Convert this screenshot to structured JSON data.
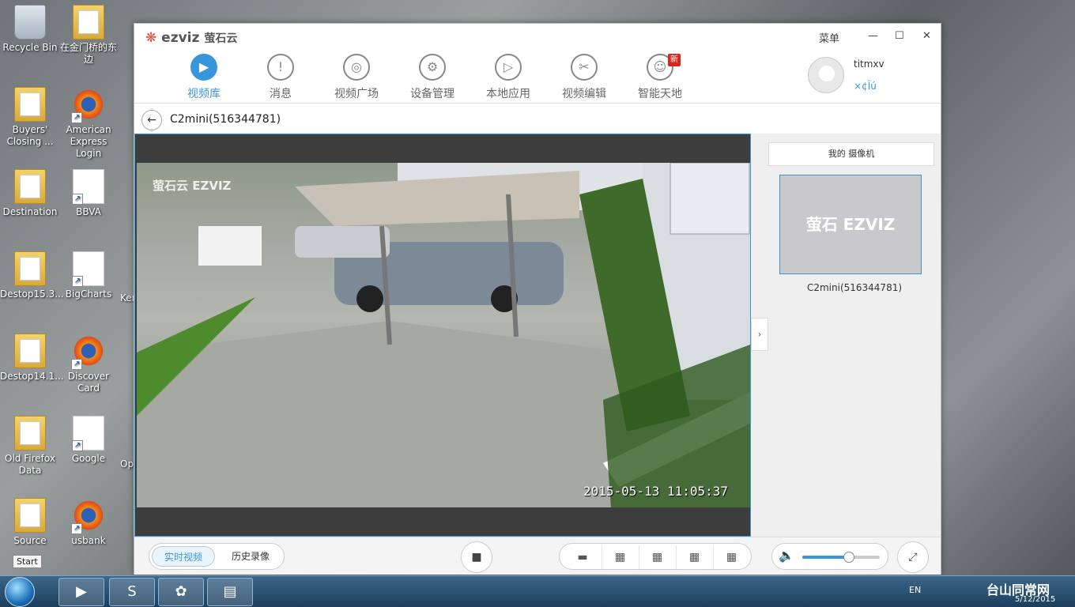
{
  "desktop": {
    "icons": [
      {
        "label": "Recycle Bin",
        "type": "trash"
      },
      {
        "label": "在金门桥的东边",
        "type": "folder"
      },
      {
        "label": "Buyers' Closing ...",
        "type": "folder"
      },
      {
        "label": "American Express Login",
        "type": "firefox"
      },
      {
        "label": "Destination",
        "type": "folder"
      },
      {
        "label": "BBVA",
        "type": "doc"
      },
      {
        "label": "Destop15.3...",
        "type": "folder"
      },
      {
        "label": "BigCharts",
        "type": "doc"
      },
      {
        "label": "Destop14.1...",
        "type": "folder"
      },
      {
        "label": "Discover Card",
        "type": "firefox"
      },
      {
        "label": "Old Firefox Data",
        "type": "folder"
      },
      {
        "label": "Google",
        "type": "doc"
      },
      {
        "label": "Source",
        "type": "folder"
      },
      {
        "label": "usbank",
        "type": "firefox"
      }
    ],
    "partial_labels": [
      "Ker",
      "Op"
    ],
    "start_tooltip": "Start"
  },
  "app": {
    "logo_text": "ezviz",
    "logo_cn": "萤石云",
    "menu_label": "菜单",
    "minimize": "—",
    "maximize": "☐",
    "close": "✕",
    "nav": [
      {
        "label": "视频库",
        "icon": "▶",
        "active": true
      },
      {
        "label": "消息",
        "icon": "!"
      },
      {
        "label": "视频广场",
        "icon": "◎"
      },
      {
        "label": "设备管理",
        "icon": "⚙"
      },
      {
        "label": "本地应用",
        "icon": "▷"
      },
      {
        "label": "视频编辑",
        "icon": "✂"
      },
      {
        "label": "智能天地",
        "icon": "☺",
        "badge": "新"
      }
    ],
    "user": {
      "name": "titmxv",
      "sub": "×¢Ïú"
    },
    "device_title": "C2mini(516344781)",
    "video": {
      "timestamp": "2015-05-13 11:05:37",
      "watermark": "萤石云 EZVIZ"
    },
    "side": {
      "tab_label": "我的 摄像机",
      "thumb_text": "萤石 EZVIZ",
      "camera_label": "C2mini(516344781)"
    },
    "bottom": {
      "live_label": "实时视频",
      "history_label": "历史录像",
      "stop_icon": "■",
      "layouts": [
        "▬",
        "▦",
        "▦",
        "▦",
        "▦"
      ],
      "volume_icon": "🔈",
      "volume_level": 0.6,
      "fullscreen_icon": "⤢"
    }
  },
  "taskbar": {
    "lang": "EN",
    "date": "5/12/2015",
    "items": [
      "▶",
      "S",
      "✿",
      "▤"
    ],
    "watermark_text": "台山同常网"
  }
}
